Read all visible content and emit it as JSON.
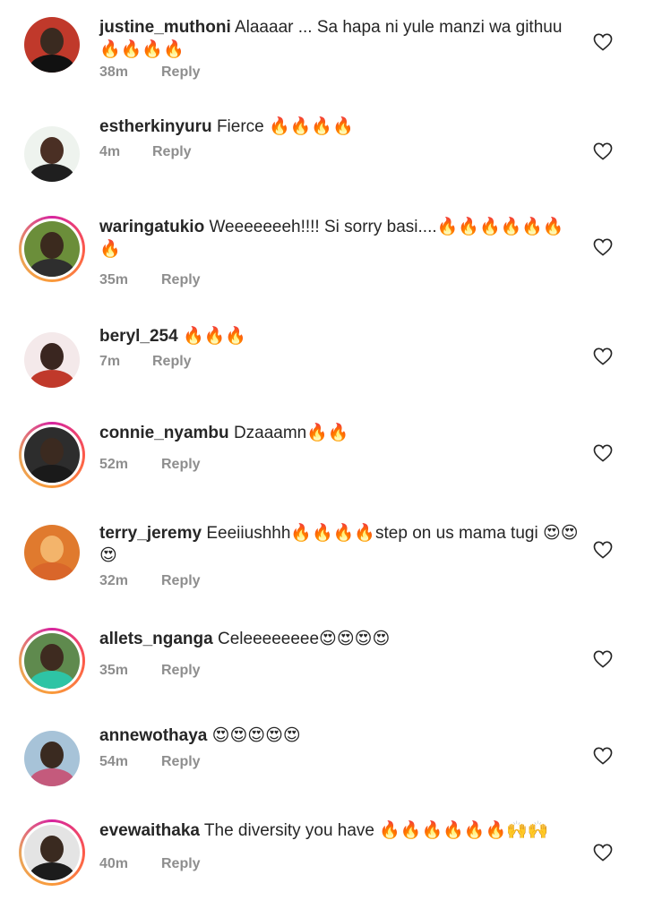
{
  "colors": {
    "username": "#262626",
    "meta": "#8e8e8e",
    "heart": "#262626"
  },
  "comments": [
    {
      "username": "justine_muthoni",
      "text": "Alaaaar ... Sa hapa ni yule manzi wa githuu 🔥🔥🔥🔥",
      "time": "38m",
      "reply": "Reply",
      "avatar_bg": "#c0392b",
      "avatar_head": "#3a2a20",
      "avatar_body": "#111111",
      "story": false
    },
    {
      "username": "estherkinyuru",
      "text": "Fierce 🔥🔥🔥🔥",
      "time": "4m",
      "reply": "Reply",
      "avatar_bg": "#eef3ee",
      "avatar_head": "#4a2f24",
      "avatar_body": "#1f1f1f",
      "story": false
    },
    {
      "username": "waringatukio",
      "text": "Weeeeeeeh!!!! Si sorry basi....🔥🔥🔥🔥🔥🔥🔥",
      "time": "35m",
      "reply": "Reply",
      "avatar_bg": "#6b8e3a",
      "avatar_head": "#3b2a1e",
      "avatar_body": "#2e2e2e",
      "story": true
    },
    {
      "username": "beryl_254",
      "text": "🔥🔥🔥",
      "time": "7m",
      "reply": "Reply",
      "avatar_bg": "#f4e9ea",
      "avatar_head": "#3a2620",
      "avatar_body": "#c0392b",
      "story": false
    },
    {
      "username": "connie_nyambu",
      "text": "Dzaaamn🔥🔥",
      "time": "52m",
      "reply": "Reply",
      "avatar_bg": "#2d2d2d",
      "avatar_head": "#3b2a20",
      "avatar_body": "#1a1a1a",
      "story": true
    },
    {
      "username": "terry_jeremy",
      "text": "Eeeiiushhh🔥🔥🔥🔥step on us mama tugi 😍😍😍",
      "time": "32m",
      "reply": "Reply",
      "avatar_bg": "#e07a2e",
      "avatar_head": "#f3b46b",
      "avatar_body": "#d9662a",
      "story": false
    },
    {
      "username": "allets_nganga",
      "text": "Celeeeeeeee😍😍😍😍",
      "time": "35m",
      "reply": "Reply",
      "avatar_bg": "#5f8a4e",
      "avatar_head": "#3e2b20",
      "avatar_body": "#2ec4a5",
      "story": true
    },
    {
      "username": "annewothaya",
      "text": "😍😍😍😍😍",
      "time": "54m",
      "reply": "Reply",
      "avatar_bg": "#a7c3d8",
      "avatar_head": "#3a2a20",
      "avatar_body": "#c45a7c",
      "story": false
    },
    {
      "username": "evewaithaka",
      "text": "The diversity you have 🔥🔥🔥🔥🔥🔥🙌🙌",
      "time": "40m",
      "reply": "Reply",
      "avatar_bg": "#e4e4e4",
      "avatar_head": "#3a2a20",
      "avatar_body": "#1c1c1c",
      "story": true
    }
  ]
}
